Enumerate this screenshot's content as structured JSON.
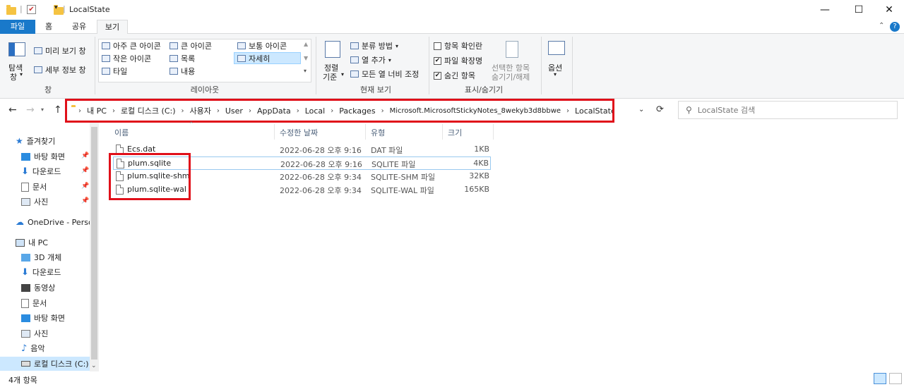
{
  "window": {
    "title": "LocalState",
    "min": "—",
    "max": "☐",
    "close": "✕"
  },
  "tabs": {
    "file": "파일",
    "home": "홈",
    "share": "공유",
    "view": "보기"
  },
  "ribbon": {
    "pane_label": "탐색\n창",
    "pane_nav": "탐색",
    "pane_nav2": "창",
    "preview": "미리 보기 창",
    "details_pane": "세부 정보 창",
    "group_pane": "창",
    "layout": {
      "extra_large": "아주 큰 아이콘",
      "large": "큰 아이콘",
      "medium": "보통 아이콘",
      "small": "작은 아이콘",
      "list": "목록",
      "details": "자세히",
      "tiles": "타일",
      "content": "내용",
      "group": "레이아웃"
    },
    "current_view": {
      "sort1": "정렬",
      "sort2": "기준",
      "group_by": "분류 방법",
      "add_columns": "열 추가",
      "fit_columns": "모든 열 너비 조정",
      "group": "현재 보기"
    },
    "show_hide": {
      "item_checkboxes": "항목 확인란",
      "file_ext": "파일 확장명",
      "hidden_items": "숨긴 항목",
      "hide_selected1": "선택한 항목",
      "hide_selected2": "숨기기/해제",
      "group": "표시/숨기기"
    },
    "options": "옵션"
  },
  "address": {
    "segments": [
      "내 PC",
      "로컬 디스크 (C:)",
      "사용자",
      "User",
      "AppData",
      "Local",
      "Packages",
      "Microsoft.MicrosoftStickyNotes_8wekyb3d8bbwe",
      "LocalState"
    ],
    "search_placeholder": "LocalState 검색"
  },
  "nav": {
    "quick_access": "즐겨찾기",
    "qa_items": [
      "바탕 화면",
      "다운로드",
      "문서",
      "사진"
    ],
    "onedrive": "OneDrive - Person",
    "this_pc": "내 PC",
    "pc_items": [
      "3D 개체",
      "다운로드",
      "동영상",
      "문서",
      "바탕 화면",
      "사진",
      "음악",
      "로컬 디스크 (C:)"
    ]
  },
  "columns": {
    "name": "이름",
    "date": "수정한 날짜",
    "type": "유형",
    "size": "크기"
  },
  "files": [
    {
      "name": "Ecs.dat",
      "date": "2022-06-28 오후 9:16",
      "type": "DAT 파일",
      "size": "1KB"
    },
    {
      "name": "plum.sqlite",
      "date": "2022-06-28 오후 9:16",
      "type": "SQLITE 파일",
      "size": "4KB"
    },
    {
      "name": "plum.sqlite-shm",
      "date": "2022-06-28 오후 9:34",
      "type": "SQLITE-SHM 파일",
      "size": "32KB"
    },
    {
      "name": "plum.sqlite-wal",
      "date": "2022-06-28 오후 9:34",
      "type": "SQLITE-WAL 파일",
      "size": "165KB"
    }
  ],
  "status": {
    "count": "4개 항목"
  },
  "colors": {
    "file_tab": "#1979ca",
    "highlight": "#e0101a",
    "selection": "#cce8ff"
  }
}
